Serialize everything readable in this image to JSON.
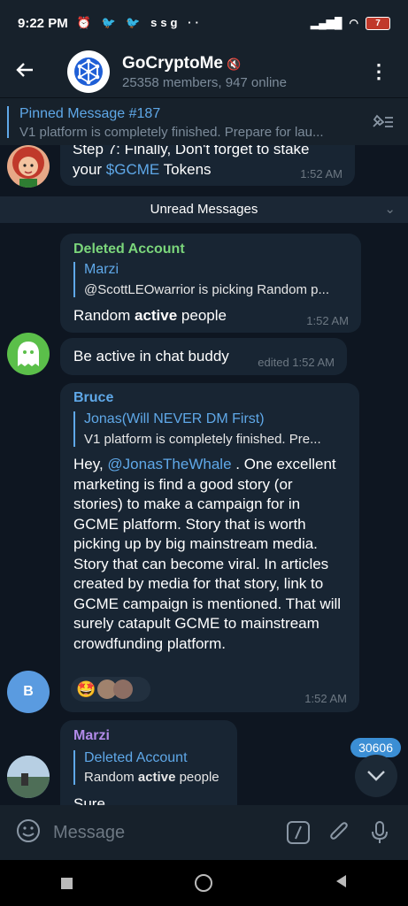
{
  "status": {
    "time": "9:22 PM",
    "battery": "7"
  },
  "header": {
    "title": "GoCryptoMe",
    "subtitle": "25358 members, 947 online"
  },
  "pinned": {
    "title": "Pinned Message #187",
    "text": "V1 platform is completely finished.  Prepare for lau..."
  },
  "chat": {
    "prev_message": {
      "line1": "Step 7:  Finally, Don't forget to stake",
      "line2_prefix": "your ",
      "line2_link": "$GCME",
      "line2_suffix": " Tokens",
      "time": "1:52 AM"
    },
    "unread_label": "Unread Messages",
    "msg1": {
      "sender": "Deleted Account",
      "reply_name": "Marzi",
      "reply_text": "@ScottLEOwarrior  is picking Random p...",
      "text_prefix": "Random ",
      "text_bold": "active",
      "text_suffix": " people",
      "time": "1:52 AM"
    },
    "msg2": {
      "text": "Be active in chat buddy",
      "time": "edited 1:52 AM"
    },
    "msg3": {
      "sender": "Bruce",
      "reply_name": "Jonas(Will NEVER DM First)",
      "reply_text": "V1 platform is completely finished.  Pre...",
      "mention": "@JonasTheWhale",
      "text_prefix": "Hey, ",
      "text_body": " . One excellent marketing is find a good story (or stories) to make a campaign for in GCME platform. Story that is worth picking up by big mainstream media. Story that can become viral. In articles created by media for that story, link to GCME campaign is mentioned. That will surely catapult GCME to mainstream crowdfunding platform.",
      "time": "1:52 AM",
      "avatar_letter": "B"
    },
    "msg4": {
      "sender": "Marzi",
      "reply_name": "Deleted Account",
      "reply_text_prefix": "Random ",
      "reply_text_bold": "active",
      "reply_text_suffix": " people",
      "text": "Sure"
    },
    "unread_count": "30606"
  },
  "input": {
    "placeholder": "Message"
  },
  "colors": {
    "accent": "#5fa8e8",
    "deleted_name": "#7bd67b",
    "bruce_name": "#5fa8e8",
    "marzi_name": "#b18ae8",
    "bubble": "#182533",
    "background": "#0e1621"
  }
}
